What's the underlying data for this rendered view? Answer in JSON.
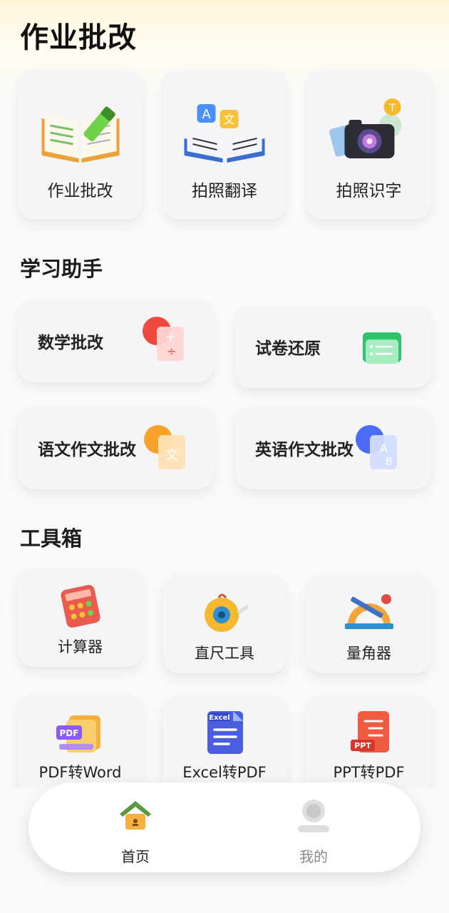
{
  "page_title": "作业批改",
  "top_cards": [
    {
      "label": "作业批改",
      "icon": "open-book-pen-icon"
    },
    {
      "label": "拍照翻译",
      "icon": "book-translate-icon"
    },
    {
      "label": "拍照识字",
      "icon": "camera-icon"
    }
  ],
  "study_section": {
    "title": "学习助手",
    "items": [
      {
        "label": "数学批改",
        "icon": "math-doc-icon",
        "color": "#f0493e"
      },
      {
        "label": "试卷还原",
        "icon": "paper-restore-icon",
        "color": "#2fc36a"
      },
      {
        "label": "语文作文批改",
        "icon": "chinese-doc-icon",
        "color": "#f7a22a"
      },
      {
        "label": "英语作文批改",
        "icon": "english-doc-icon",
        "color": "#4a6cf7"
      }
    ]
  },
  "toolbox": {
    "title": "工具箱",
    "items": [
      {
        "label": "计算器",
        "icon": "calculator-icon"
      },
      {
        "label": "直尺工具",
        "icon": "tape-measure-icon"
      },
      {
        "label": "量角器",
        "icon": "protractor-icon"
      },
      {
        "label": "PDF转Word",
        "icon": "pdf-to-word-icon",
        "badge": "PDF"
      },
      {
        "label": "Excel转PDF",
        "icon": "excel-to-pdf-icon",
        "badge": "Excel"
      },
      {
        "label": "PPT转PDF",
        "icon": "ppt-to-pdf-icon",
        "badge": "PPT"
      }
    ]
  },
  "bottom_nav": [
    {
      "label": "首页",
      "icon": "home-icon",
      "active": true
    },
    {
      "label": "我的",
      "icon": "profile-icon",
      "active": false
    }
  ]
}
